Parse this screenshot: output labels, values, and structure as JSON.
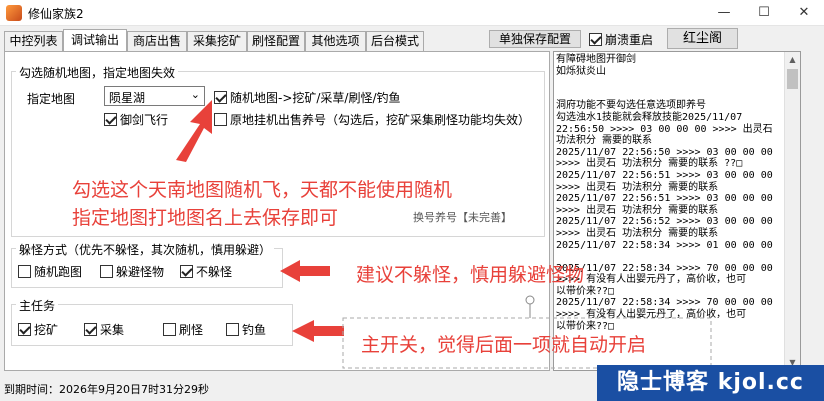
{
  "window": {
    "title": "修仙家族2"
  },
  "tabs": [
    {
      "label": "中控列表"
    },
    {
      "label": "调试输出"
    },
    {
      "label": "商店出售"
    },
    {
      "label": "采集挖矿"
    },
    {
      "label": "刷怪配置"
    },
    {
      "label": "其他选项"
    },
    {
      "label": "后台模式"
    }
  ],
  "toolbar": {
    "save_config": "单独保存配置",
    "crash_restart": "崩溃重启",
    "red_dust": "红尘阁"
  },
  "map": {
    "group_title": "勾选随机地图，指定地图失效",
    "map_label": "指定地图",
    "map_value": "陨星湖",
    "random_map": "随机地图->挖矿/采草/刷怪/钓鱼",
    "sword_fly": "御剑飞行",
    "afk_sell": "原地挂机出售养号（勾选后，挖矿采集刷怪功能均失效）",
    "switch_account": "换号养号【未完善】"
  },
  "avoid": {
    "group_title": "躲怪方式（优先不躲怪，其次随机，慎用躲避）",
    "random_run": "随机跑图",
    "avoid_mob": "躲避怪物",
    "no_avoid": "不躲怪"
  },
  "main_task": {
    "group_title": "主任务",
    "mining": "挖矿",
    "gather": "采集",
    "fight": "刷怪",
    "fishing": "钓鱼"
  },
  "annotations": {
    "line1": "勾选这个天南地图随机飞，天都不能使用随机",
    "line2": "指定地图打地图名上去保存即可",
    "avoid_tip": "建议不躲怪，慎用躲避怪物",
    "main_tip": "主开关，觉得后面一项就自动开启"
  },
  "log": {
    "text": "有障碍地图开御剑\n如烁狱炎山\n\n\n洞府功能不要勾选任意选项即养号\n勾选浊水1技能就会释放技能2025/11/07\n22:56:50 >>>> 03 00 00 00 >>>> 出灵石\n功法积分 需要的联系\n2025/11/07 22:56:50 >>>> 03 00 00 00\n>>>> 出灵石 功法积分 需要的联系 ??□\n2025/11/07 22:56:51 >>>> 03 00 00 00\n>>>> 出灵石 功法积分 需要的联系\n2025/11/07 22:56:51 >>>> 03 00 00 00\n>>>> 出灵石 功法积分 需要的联系\n2025/11/07 22:56:52 >>>> 03 00 00 00\n>>>> 出灵石 功法积分 需要的联系\n2025/11/07 22:58:34 >>>> 01 00 00 00\n\n2025/11/07 22:58:34 >>>> 70 00 00 00\n>>>> 有没有人出婴元丹了，高价收，也可\n以带价来??□\n2025/11/07 22:58:34 >>>> 70 00 00 00\n>>>> 有没有人出婴元丹了，高价收，也可\n以带价来??□"
  },
  "status": {
    "expiry": "到期时间：2026年9月20日7时31分29秒"
  },
  "watermark": {
    "text": "隐士博客 kjol.cc"
  },
  "colors": {
    "annotation": "#e8413a",
    "watermark_bg": "#1a4fa3"
  }
}
